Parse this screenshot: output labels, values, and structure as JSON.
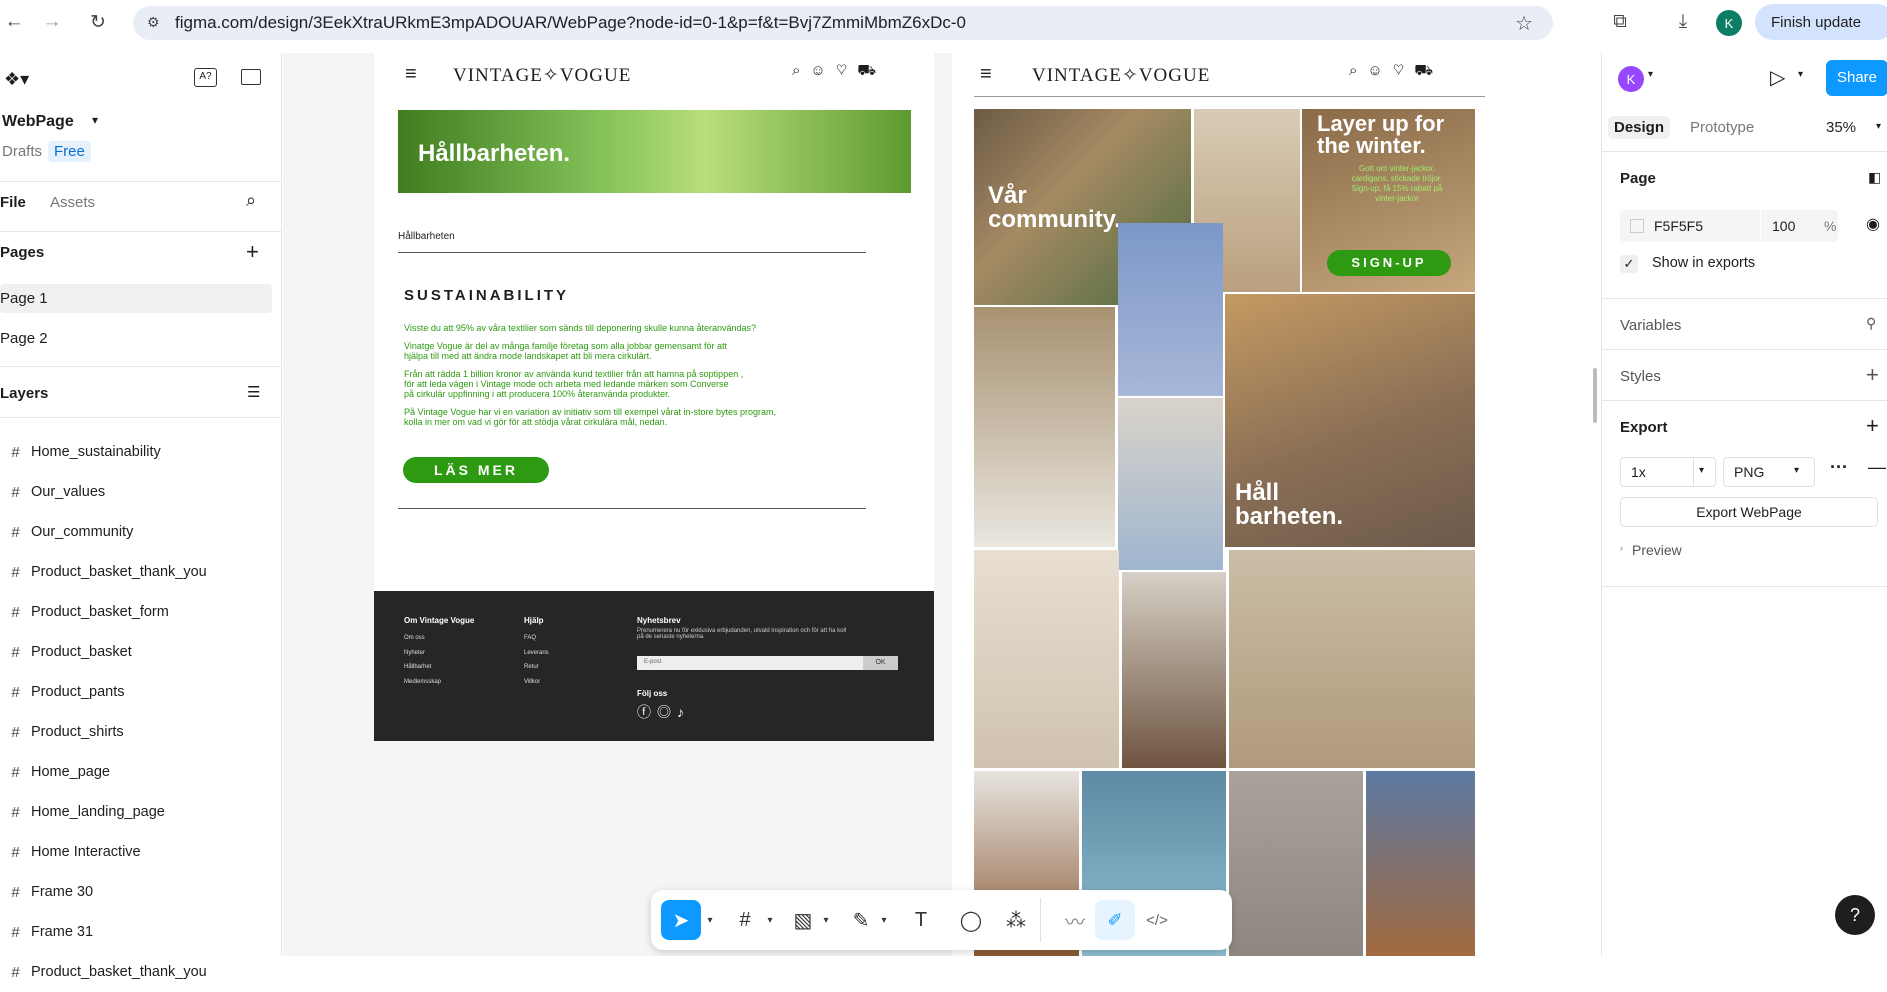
{
  "browser": {
    "url": "figma.com/design/3EekXtraURkmE3mpADOUAR/WebPage?node-id=0-1&p=f&t=Bvj7ZmmiMbmZ6xDc-0",
    "finish_update": "Finish update",
    "profile_initial": "K"
  },
  "left_panel": {
    "file_name": "WebPage",
    "drafts": "Drafts",
    "plan": "Free",
    "tab_file": "File",
    "tab_assets": "Assets",
    "pages_title": "Pages",
    "pages": [
      "Page 1",
      "Page 2"
    ],
    "layers_title": "Layers",
    "layers": [
      "Home_sustainability",
      "Our_values",
      "Our_community",
      "Product_basket_thank_you",
      "Product_basket_form",
      "Product_basket",
      "Product_pants",
      "Product_shirts",
      "Home_page",
      "Home_landing_page",
      "Home Interactive",
      "Frame 30",
      "Frame 31",
      "Product_basket_thank_you"
    ]
  },
  "frame_left": {
    "brand": "VINTAGE✧VOGUE",
    "hero_text": "Hållbarheten.",
    "breadcrumb": "Hållbarheten",
    "heading": "SUSTAINABILITY",
    "para1": "Visste du att 95% av våra textilier som sänds till deponering skulle kunna återanvändas?",
    "para2a": "Vinatge Vogue är del av många familje företag som alla jobbar gemensamt för att",
    "para2b": "hjälpa till med att ändra mode landskapet att bli mera cirkulärt.",
    "para3a": "Från att rädda 1 billion kronor av använda kund textilier från att hamna på soptippen ,",
    "para3b": "för att leda vägen i Vintage mode och arbeta med ledande märken som Converse",
    "para3c": "på cirkulär uppfinning i att producera 100% återanvända produkter.",
    "para4a": "På Vintage Vogue har vi en variation av initiativ som till exempel vårat in-store bytes program,",
    "para4b": "kolla in mer om vad vi gör för att stödja vårat cirkulära mål, nedan.",
    "cta": "LÄS MER",
    "footer": {
      "col1_title": "Om Vintage Vogue",
      "col1": [
        "Om oss",
        "Nyheter",
        "Hållbarhet",
        "Medlemsskap"
      ],
      "col2_title": "Hjälp",
      "col2": [
        "FAQ",
        "Leverans",
        "Retur",
        "Villkor"
      ],
      "news_title": "Nyhetsbrev",
      "news_text1": "Prenumerera nu för exklusiva erbjudanden, utvald inspiration och för att ha koll",
      "news_text2": "på de senaste nyheterna.",
      "email_placeholder": "E-post",
      "ok": "OK",
      "follow": "Följ oss"
    }
  },
  "frame_right": {
    "brand": "VINTAGE✧VOGUE",
    "community": "Vår community.",
    "layer_up": "Layer up for the winter.",
    "layer_up_small": "Gott om vinter-jackor, cardigans, stickade tröjor. Sign-up, få 15% rabatt på vinter-jackor",
    "signup": "SIGN-UP",
    "hall": "Håll barheten."
  },
  "right_panel": {
    "initial": "K",
    "share": "Share",
    "tab_design": "Design",
    "tab_prototype": "Prototype",
    "zoom": "35%",
    "page_title": "Page",
    "page_color": "F5F5F5",
    "page_opacity": "100",
    "percent": "%",
    "show_exports": "Show in exports",
    "variables": "Variables",
    "styles": "Styles",
    "export": "Export",
    "scale": "1x",
    "format": "PNG",
    "export_button": "Export WebPage",
    "preview": "Preview"
  },
  "help": "?"
}
